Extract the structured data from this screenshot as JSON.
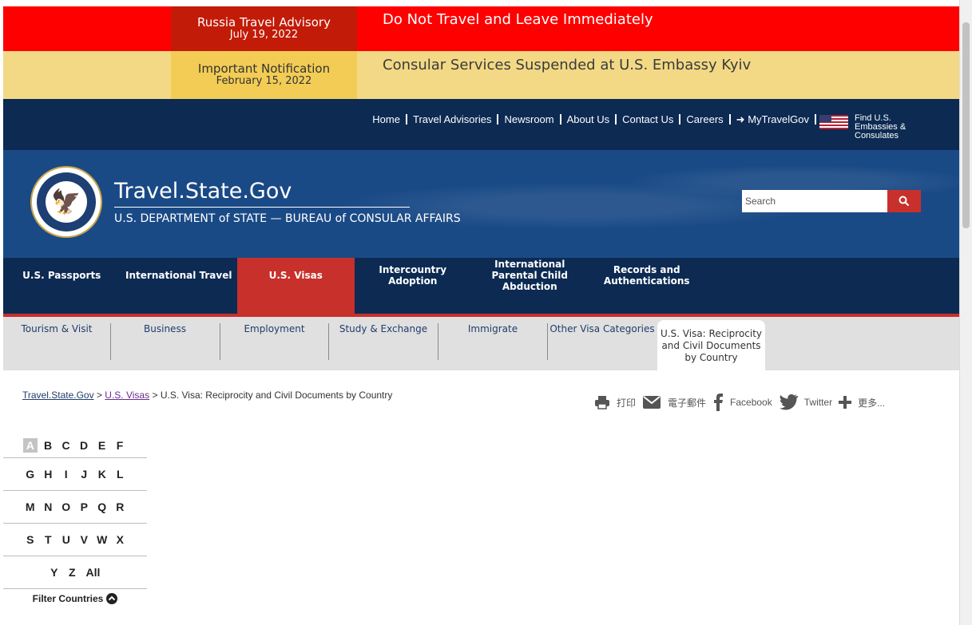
{
  "alerts": [
    {
      "title": "Russia Travel Advisory",
      "date": "July 19, 2022",
      "message": "Do Not Travel and Leave Immediately"
    },
    {
      "title": "Important Notification",
      "date": "February 15, 2022",
      "message": "Consular Services Suspended at U.S. Embassy Kyiv"
    }
  ],
  "utility_nav": {
    "links": [
      "Home",
      "Travel Advisories",
      "Newsroom",
      "About Us",
      "Contact Us",
      "Careers",
      "MyTravelGov"
    ],
    "find_embassies": "Find U.S. Embassies & Consulates"
  },
  "header": {
    "site_title": "Travel.State.Gov",
    "subtitle": "U.S. DEPARTMENT of STATE — BUREAU of CONSULAR AFFAIRS",
    "search_placeholder": "Search"
  },
  "main_nav": [
    "U.S. Passports",
    "International Travel",
    "U.S. Visas",
    "Intercountry Adoption",
    "International Parental Child Abduction",
    "Records and Authentications"
  ],
  "main_nav_active": "U.S. Visas",
  "sub_nav": [
    "Tourism & Visit",
    "Business",
    "Employment",
    "Study & Exchange",
    "Immigrate",
    "Other Visa Categories",
    "U.S. Visa: Reciprocity and Civil Documents by Country"
  ],
  "breadcrumb": {
    "home": "Travel.State.Gov",
    "section": "U.S. Visas",
    "current": "U.S. Visa: Reciprocity and Civil Documents by Country",
    "sep": ">"
  },
  "share": {
    "print": "打印",
    "email": "電子郵件",
    "facebook": "Facebook",
    "twitter": "Twitter",
    "more": "更多..."
  },
  "alphabet": {
    "rows": [
      [
        "A",
        "B",
        "C",
        "D",
        "E",
        "F"
      ],
      [
        "G",
        "H",
        "I",
        "J",
        "K",
        "L"
      ],
      [
        "M",
        "N",
        "O",
        "P",
        "Q",
        "R"
      ],
      [
        "S",
        "T",
        "U",
        "V",
        "W",
        "X"
      ],
      [
        "Y",
        "Z",
        "All"
      ]
    ],
    "selected": "A",
    "filter_label": "Filter Countries"
  },
  "colors": {
    "red_alert": "#ff0000",
    "yellow_alert": "#f3d985",
    "navy": "#0c2a52",
    "accent_red": "#c8302c"
  }
}
